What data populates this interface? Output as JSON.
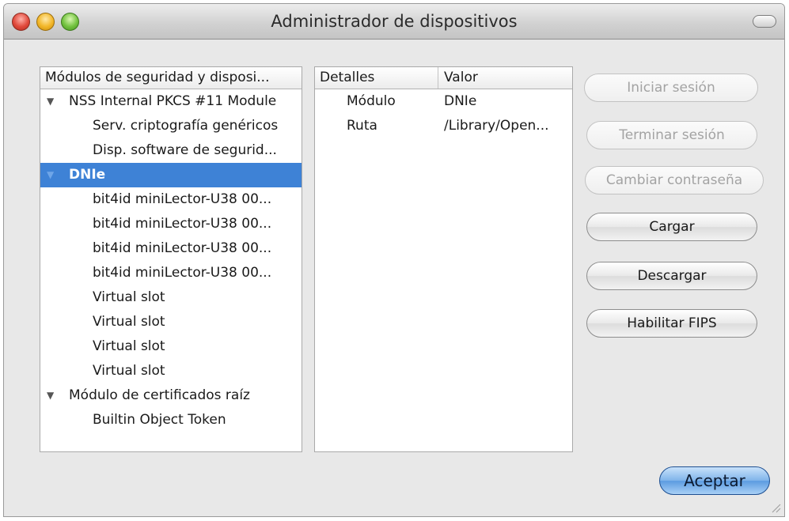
{
  "window": {
    "title": "Administrador de dispositivos"
  },
  "tree": {
    "header": "Módulos de seguridad y disposi...",
    "items": [
      {
        "label": "NSS Internal PKCS #11 Module",
        "level": 0,
        "expanded": true,
        "selected": false
      },
      {
        "label": "Serv. criptografía genéricos",
        "level": 1,
        "selected": false
      },
      {
        "label": "Disp. software de segurid...",
        "level": 1,
        "selected": false
      },
      {
        "label": "DNIe",
        "level": 0,
        "expanded": true,
        "selected": true
      },
      {
        "label": "bit4id miniLector-U38 00...",
        "level": 1,
        "selected": false
      },
      {
        "label": "bit4id miniLector-U38 00...",
        "level": 1,
        "selected": false
      },
      {
        "label": "bit4id miniLector-U38 00...",
        "level": 1,
        "selected": false
      },
      {
        "label": "bit4id miniLector-U38 00...",
        "level": 1,
        "selected": false
      },
      {
        "label": "Virtual slot",
        "level": 1,
        "selected": false
      },
      {
        "label": "Virtual slot",
        "level": 1,
        "selected": false
      },
      {
        "label": "Virtual slot",
        "level": 1,
        "selected": false
      },
      {
        "label": "Virtual slot",
        "level": 1,
        "selected": false
      },
      {
        "label": "Módulo de certificados raíz",
        "level": 0,
        "expanded": true,
        "selected": false
      },
      {
        "label": "Builtin Object Token",
        "level": 1,
        "selected": false
      }
    ]
  },
  "details": {
    "header_details": "Detalles",
    "header_value": "Valor",
    "rows": [
      {
        "key": "Módulo",
        "value": "DNIe"
      },
      {
        "key": "Ruta",
        "value": "/Library/Open..."
      }
    ]
  },
  "buttons": {
    "login": "Iniciar sesión",
    "logout": "Terminar sesión",
    "change_password": "Cambiar contraseña",
    "load": "Cargar",
    "unload": "Descargar",
    "enable_fips": "Habilitar FIPS",
    "accept": "Aceptar"
  },
  "colors": {
    "selection": "#3e82d6",
    "default_button": "#5b9be0"
  }
}
